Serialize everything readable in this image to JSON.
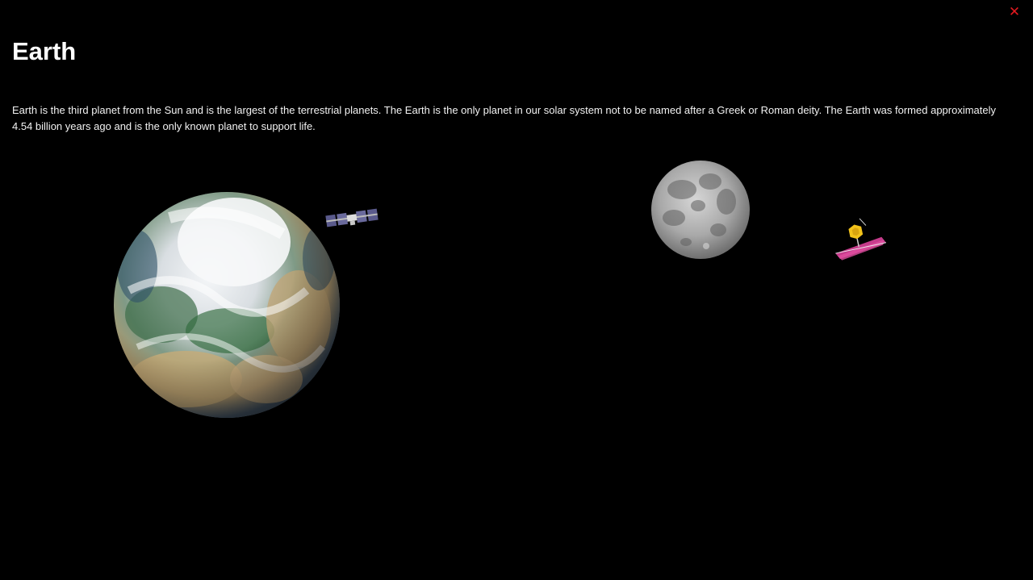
{
  "header": {
    "title": "Earth",
    "close_icon": "close-icon",
    "close_symbol": "✕",
    "close_color": "#e0191f"
  },
  "content": {
    "description": "Earth is the third planet from the Sun and is the largest of the terrestrial planets. The Earth is the only planet in our solar system not to be named after a Greek or Roman deity. The Earth was formed approximately 4.54 billion years ago and is the only known planet to support life."
  },
  "scene": {
    "background_color": "#000000",
    "objects": [
      {
        "name": "earth-planet",
        "icon": "earth-globe-image"
      },
      {
        "name": "iss-satellite",
        "icon": "space-station-image"
      },
      {
        "name": "moon",
        "icon": "moon-image"
      },
      {
        "name": "jwst-telescope",
        "icon": "space-telescope-image"
      }
    ]
  }
}
